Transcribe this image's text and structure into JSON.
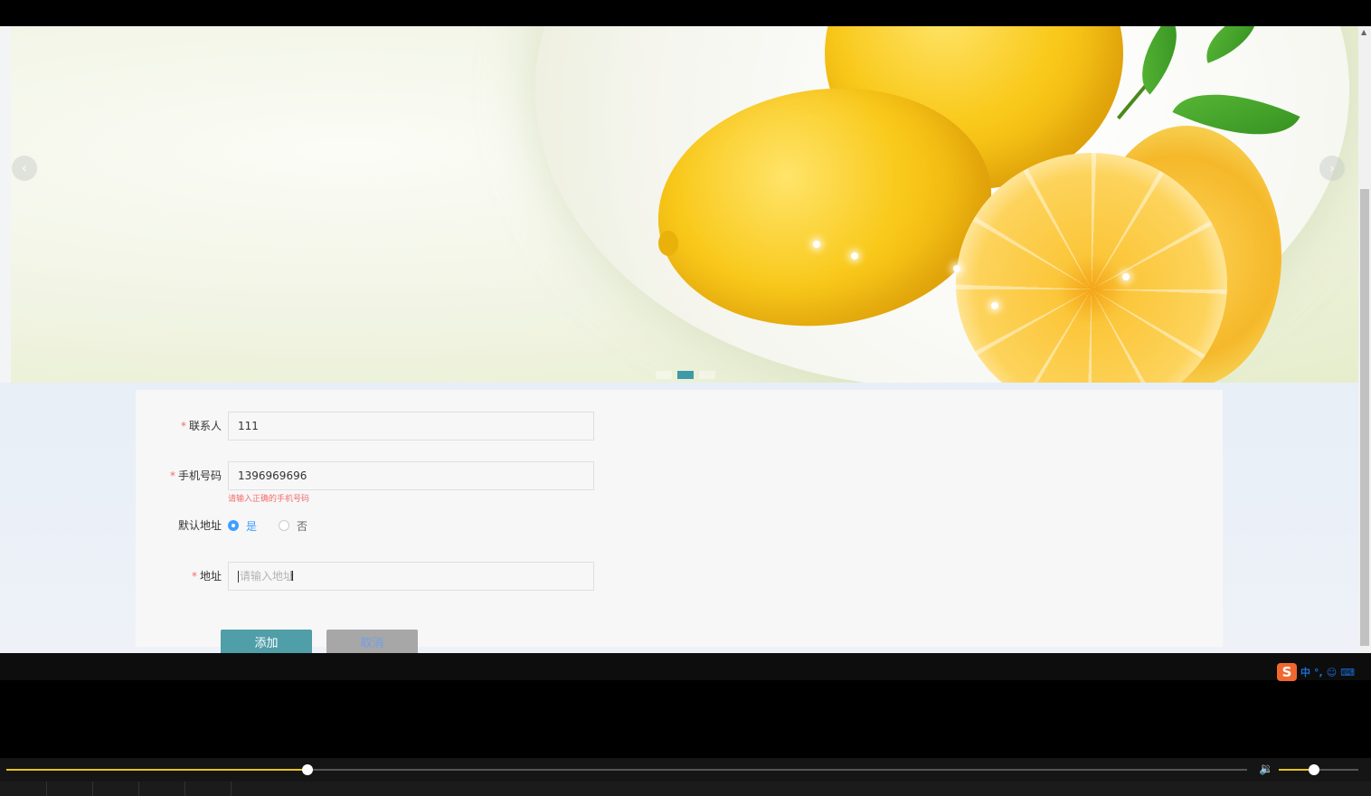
{
  "banner": {
    "prev_icon": "chevron-left-icon",
    "next_icon": "chevron-right-icon",
    "prev_glyph": "‹",
    "next_glyph": "›",
    "indicator_count": 3,
    "active_indicator": 1,
    "accent_color": "#3e9aa6"
  },
  "form": {
    "contact": {
      "label": "联系人",
      "value": "111",
      "required": true
    },
    "phone": {
      "label": "手机号码",
      "value": "1396969696",
      "required": true,
      "error": "请输入正确的手机号码"
    },
    "default_address": {
      "label": "默认地址",
      "options": [
        {
          "label": "是",
          "checked": true
        },
        {
          "label": "否",
          "checked": false
        }
      ]
    },
    "address": {
      "label": "地址",
      "value": "",
      "placeholder": "请输入地址",
      "required": true
    },
    "required_mark": "*",
    "error_color": "#f56c6c",
    "radio_color": "#409eff"
  },
  "buttons": {
    "add": "添加",
    "cancel": "取消",
    "add_color": "#4f9ea8",
    "cancel_color": "#a7a7a7"
  },
  "ime": {
    "logo": "S",
    "items": [
      "中",
      "°,",
      "☺",
      "⌨"
    ]
  },
  "player": {
    "progress": 0.243,
    "volume": 0.44,
    "volume_icon": "volume-icon",
    "volume_glyph": "🔉",
    "accent_color": "#e8c21c"
  }
}
